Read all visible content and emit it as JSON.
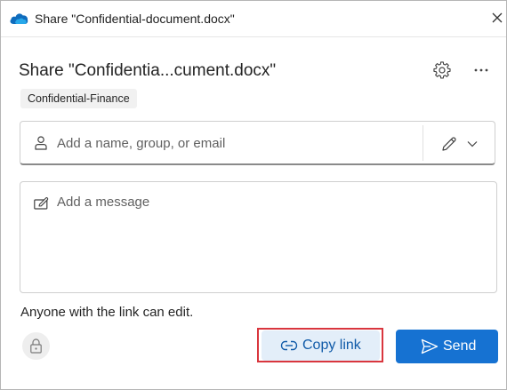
{
  "window": {
    "title": "Share \"Confidential-document.docx\"",
    "icon": "onedrive-cloud-icon",
    "close_icon": "close-icon"
  },
  "dialog": {
    "heading": "Share \"Confidentia...cument.docx\"",
    "settings_icon": "gear-icon",
    "more_icon": "more-options-icon",
    "sensitivity_label": "Confidential-Finance"
  },
  "recipients": {
    "placeholder": "Add a name, group, or email",
    "value": "",
    "person_icon": "person-icon",
    "permission_icon": "pencil-icon",
    "permission_dropdown_icon": "chevron-down-icon"
  },
  "message": {
    "placeholder": "Add a message",
    "value": "",
    "icon": "compose-icon"
  },
  "link_settings": {
    "text": "Anyone with the link can edit."
  },
  "actions": {
    "lock_icon": "lock-icon",
    "copy_link_label": "Copy link",
    "copy_link_icon": "link-icon",
    "send_label": "Send",
    "send_icon": "send-icon"
  },
  "colors": {
    "primary": "#1672d2",
    "copy_link_bg": "#e3eef9",
    "copy_link_text": "#0f5aa8",
    "highlight": "#d9363e"
  }
}
